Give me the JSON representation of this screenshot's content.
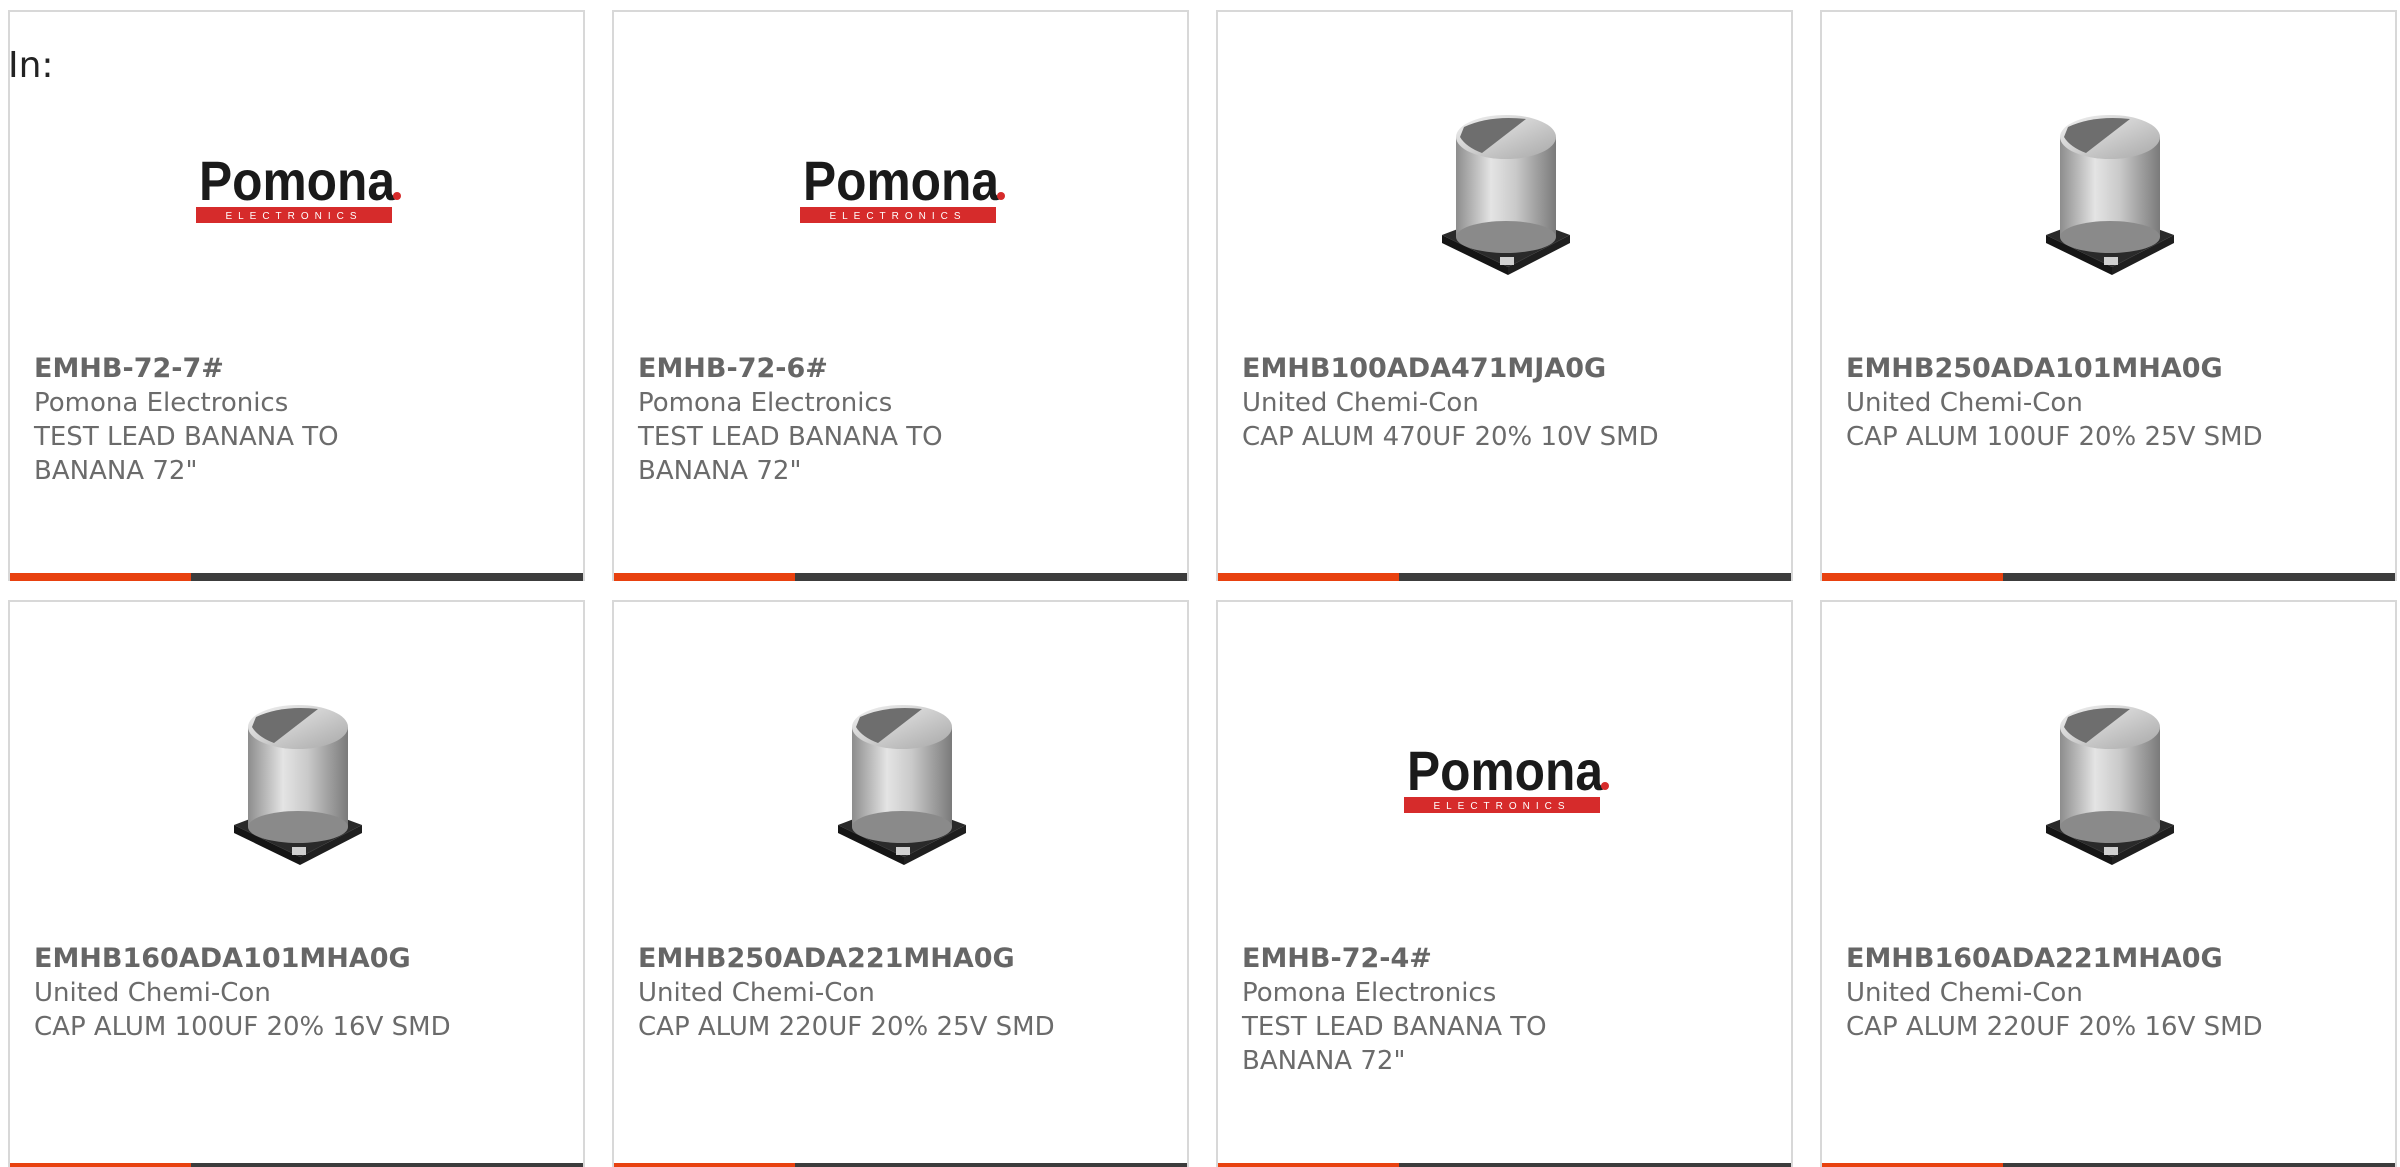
{
  "filter_label": "In:",
  "brand_logo_text": {
    "main": "Pomona",
    "sub": "ELECTRONICS"
  },
  "colors": {
    "accent": "#e8410f",
    "bar": "#3c3c3c",
    "logo_red": "#d62b2b"
  },
  "products": [
    {
      "part_number": "EMHB-72-7#",
      "manufacturer": "Pomona Electronics",
      "description": "TEST LEAD BANANA TO BANANA 72\"",
      "image": "pomona-logo"
    },
    {
      "part_number": "EMHB-72-6#",
      "manufacturer": "Pomona Electronics",
      "description": "TEST LEAD BANANA TO BANANA 72\"",
      "image": "pomona-logo"
    },
    {
      "part_number": "EMHB100ADA471MJA0G",
      "manufacturer": "United Chemi-Con",
      "description": "CAP ALUM 470UF 20% 10V SMD",
      "image": "capacitor-photo"
    },
    {
      "part_number": "EMHB250ADA101MHA0G",
      "manufacturer": "United Chemi-Con",
      "description": "CAP ALUM 100UF 20% 25V SMD",
      "image": "capacitor-photo"
    },
    {
      "part_number": "EMHB160ADA101MHA0G",
      "manufacturer": "United Chemi-Con",
      "description": "CAP ALUM 100UF 20% 16V SMD",
      "image": "capacitor-photo"
    },
    {
      "part_number": "EMHB250ADA221MHA0G",
      "manufacturer": "United Chemi-Con",
      "description": "CAP ALUM 220UF 20% 25V SMD",
      "image": "capacitor-photo"
    },
    {
      "part_number": "EMHB-72-4#",
      "manufacturer": "Pomona Electronics",
      "description": "TEST LEAD BANANA TO BANANA 72\"",
      "image": "pomona-logo"
    },
    {
      "part_number": "EMHB160ADA221MHA0G",
      "manufacturer": "United Chemi-Con",
      "description": "CAP ALUM 220UF 20% 16V SMD",
      "image": "capacitor-photo"
    }
  ]
}
